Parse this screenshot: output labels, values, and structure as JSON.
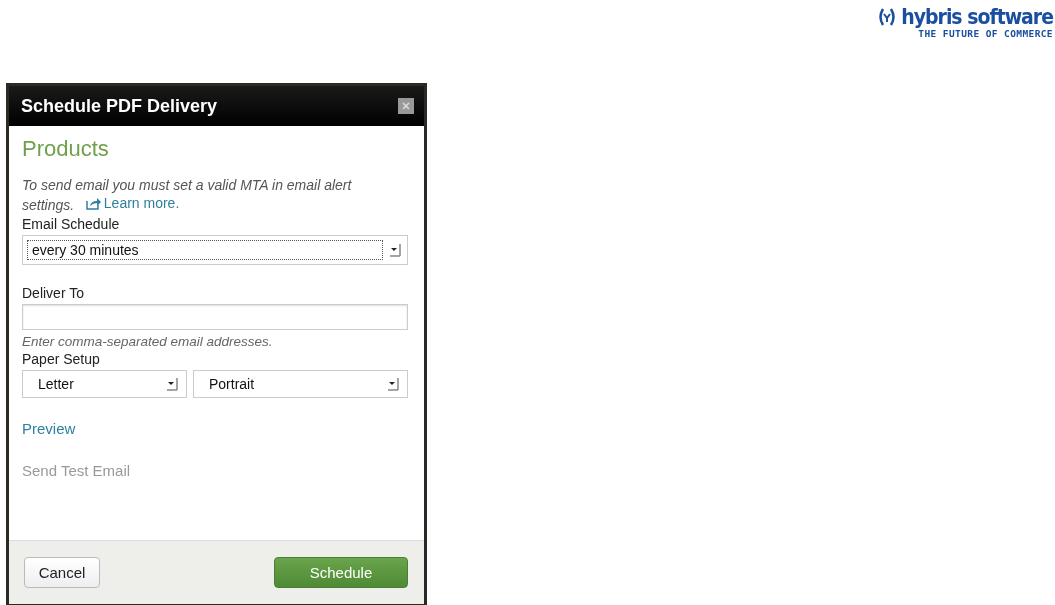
{
  "brand": {
    "name": "hybris software",
    "tagline": "THE FUTURE OF COMMERCE"
  },
  "dialog": {
    "title": "Schedule PDF Delivery",
    "heading": "Products",
    "notice": "To send email you must set a valid MTA in email alert settings.",
    "notice_link": "Learn more.",
    "schedule": {
      "label": "Email Schedule",
      "value": "every 30 minutes",
      "focused": true
    },
    "deliver_to": {
      "label": "Deliver To",
      "help": "Enter comma-separated email addresses."
    },
    "paper_setup": {
      "label": "Paper Setup",
      "selects": [
        {
          "value": "Letter"
        },
        {
          "value": "Portrait"
        }
      ]
    },
    "links": [
      {
        "label": "Preview",
        "disabled": false
      },
      {
        "label": "Send Test Email",
        "disabled": true
      }
    ],
    "buttons": [
      {
        "label": "Cancel",
        "kind": "secondary"
      },
      {
        "label": "Schedule",
        "kind": "primary"
      }
    ]
  }
}
